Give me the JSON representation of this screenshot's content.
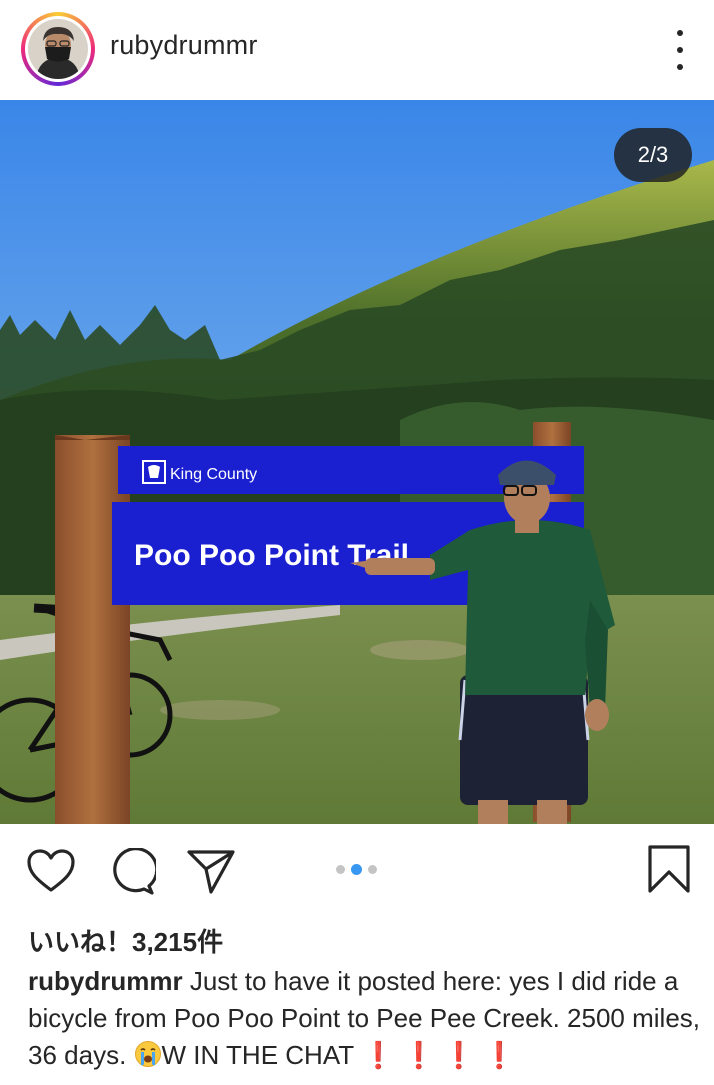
{
  "post": {
    "username": "rubydrummr",
    "image_counter": "2/3",
    "sign_top_text": "King County",
    "sign_main_text": "Poo Poo Point Trail",
    "carousel": {
      "total": 3,
      "active": 2
    },
    "likes_text": "いいね！3,215件",
    "caption_user": "rubydrummr",
    "caption_text": "Just to have it posted here: yes I did ride a bicycle from Poo Poo Point to Pee Pee Creek. 2500 miles, 36 days.",
    "caption_tail": "W IN THE CHAT",
    "caption_marks": [
      "❗",
      "❗",
      "❗",
      "❗"
    ]
  },
  "icons": {
    "like": "heart-icon",
    "comment": "comment-bubble-icon",
    "share": "paper-plane-icon",
    "save": "bookmark-icon",
    "more": "vertical-ellipsis-icon",
    "crying_emoji": "loudly-crying-face-icon"
  },
  "colors": {
    "text": "#262626",
    "accent": "#3897f0",
    "sign_blue": "#1a1fd0",
    "exclamation": "#e0243a"
  }
}
